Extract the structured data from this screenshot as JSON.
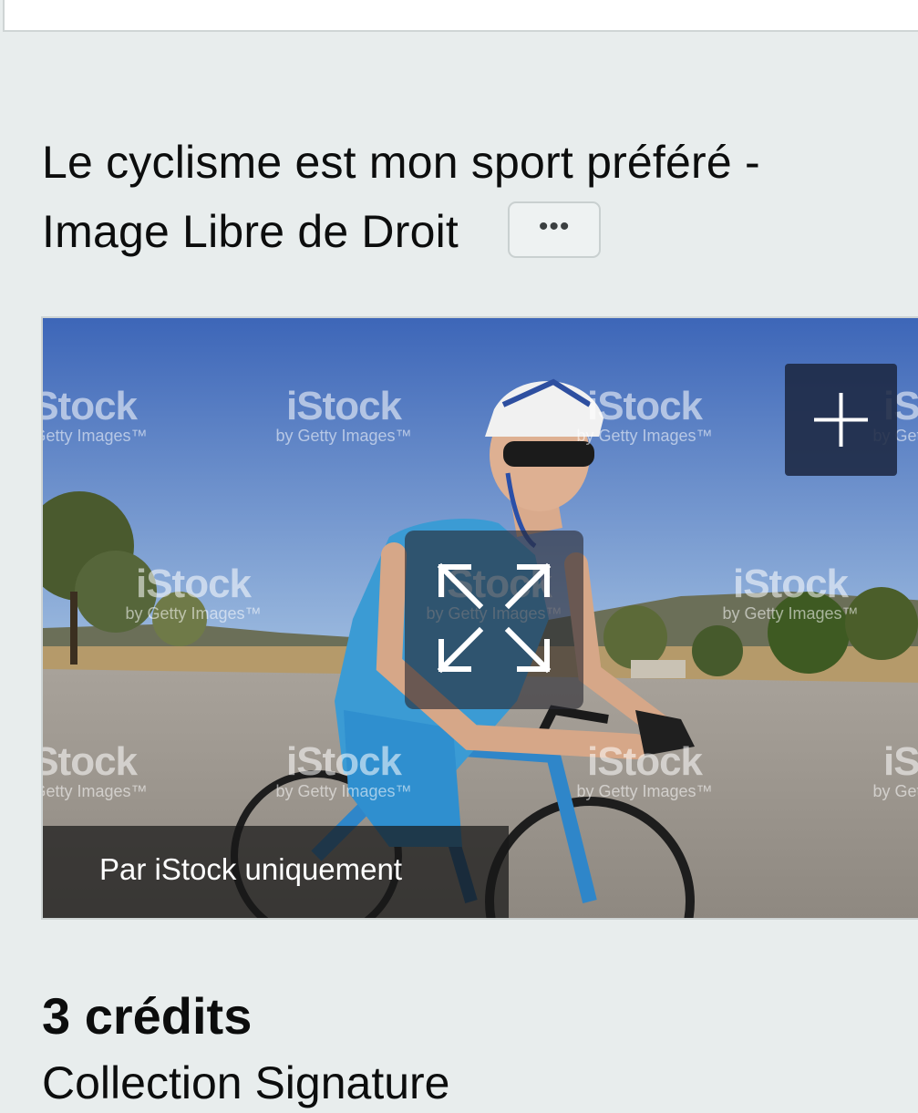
{
  "page": {
    "title": "Le cyclisme est mon sport préféré - Image Libre de Droit",
    "more_label": "•••"
  },
  "image": {
    "alt": "Le cyclisme est mon sport préféré",
    "watermark_brand": "iStock",
    "watermark_sub": "by Getty Images™",
    "caption": "Par iStock uniquement",
    "add_icon": "plus-icon",
    "expand_icon": "expand-arrows-icon"
  },
  "pricing": {
    "credits": "3 crédits",
    "collection": "Collection Signature"
  },
  "colors": {
    "background": "#e8eded",
    "add_button": "#1c2842",
    "caption_bar": "#181818",
    "sky": "#4f7cc4"
  }
}
